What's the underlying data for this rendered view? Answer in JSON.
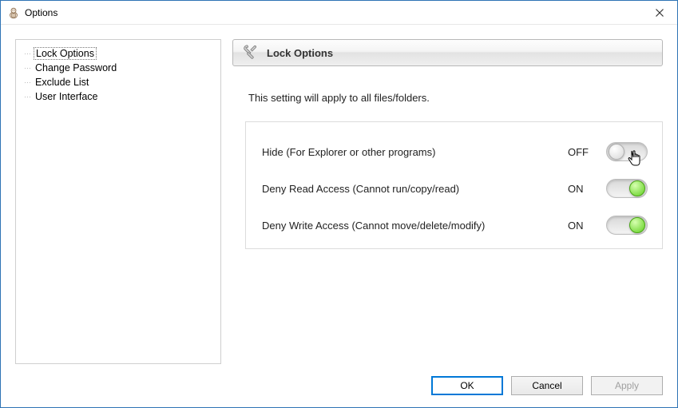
{
  "window": {
    "title": "Options"
  },
  "nav": {
    "items": [
      {
        "label": "Lock Options",
        "selected": true
      },
      {
        "label": "Change Password",
        "selected": false
      },
      {
        "label": "Exclude List",
        "selected": false
      },
      {
        "label": "User Interface",
        "selected": false
      }
    ]
  },
  "panel": {
    "title": "Lock Options",
    "description": "This setting will apply to all files/folders."
  },
  "settings": [
    {
      "label": "Hide (For Explorer or other programs)",
      "state": "OFF",
      "on": false
    },
    {
      "label": "Deny Read Access (Cannot run/copy/read)",
      "state": "ON",
      "on": true
    },
    {
      "label": "Deny Write Access (Cannot move/delete/modify)",
      "state": "ON",
      "on": true
    }
  ],
  "buttons": {
    "ok": "OK",
    "cancel": "Cancel",
    "apply": "Apply"
  }
}
